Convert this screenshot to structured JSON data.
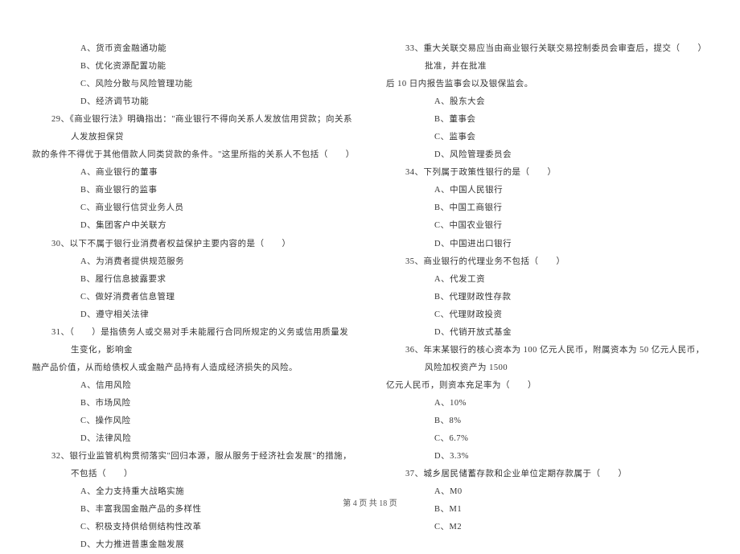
{
  "left": {
    "q28_options": [
      "A、货币资金融通功能",
      "B、优化资源配置功能",
      "C、风险分散与风险管理功能",
      "D、经济调节功能"
    ],
    "q29": "29、《商业银行法》明确指出：\"商业银行不得向关系人发放信用贷款；向关系人发放担保贷",
    "q29_cont": "款的条件不得优于其他借款人同类贷款的条件。\"这里所指的关系人不包括（　　）",
    "q29_options": [
      "A、商业银行的董事",
      "B、商业银行的监事",
      "C、商业银行信贷业务人员",
      "D、集团客户中关联方"
    ],
    "q30": "30、以下不属于银行业消费者权益保护主要内容的是（　　）",
    "q30_options": [
      "A、为消费者提供规范服务",
      "B、履行信息披露要求",
      "C、做好消费者信息管理",
      "D、遵守相关法律"
    ],
    "q31": "31、（　　）是指债务人或交易对手未能履行合同所规定的义务或信用质量发生变化，影响金",
    "q31_cont": "融产品价值，从而给债权人或金融产品持有人造成经济损失的风险。",
    "q31_options": [
      "A、信用风险",
      "B、市场风险",
      "C、操作风险",
      "D、法律风险"
    ],
    "q32": "32、银行业监管机构贯彻落实\"回归本源，服从服务于经济社会发展\"的措施，不包括（　　）",
    "q32_options": [
      "A、全力支持重大战略实施",
      "B、丰富我国金融产品的多样性",
      "C、积极支持供给侧结构性改革",
      "D、大力推进普惠金融发展"
    ]
  },
  "right": {
    "q33": "33、重大关联交易应当由商业银行关联交易控制委员会审查后，提交（　　）批准，并在批准",
    "q33_cont": "后 10 日内报告监事会以及银保监会。",
    "q33_options": [
      "A、股东大会",
      "B、董事会",
      "C、监事会",
      "D、风险管理委员会"
    ],
    "q34": "34、下列属于政策性银行的是（　　）",
    "q34_options": [
      "A、中国人民银行",
      "B、中国工商银行",
      "C、中国农业银行",
      "D、中国进出口银行"
    ],
    "q35": "35、商业银行的代理业务不包括（　　）",
    "q35_options": [
      "A、代发工资",
      "B、代理财政性存款",
      "C、代理财政投资",
      "D、代销开放式基金"
    ],
    "q36": "36、年末某银行的核心资本为 100 亿元人民币，附属资本为 50 亿元人民币，风险加权资产为 1500",
    "q36_cont": "亿元人民币，则资本充足率为（　　）",
    "q36_options": [
      "A、10%",
      "B、8%",
      "C、6.7%",
      "D、3.3%"
    ],
    "q37": "37、城乡居民储蓄存款和企业单位定期存款属于（　　）",
    "q37_options": [
      "A、M0",
      "B、M1",
      "C、M2"
    ]
  },
  "footer": "第 4 页 共 18 页"
}
